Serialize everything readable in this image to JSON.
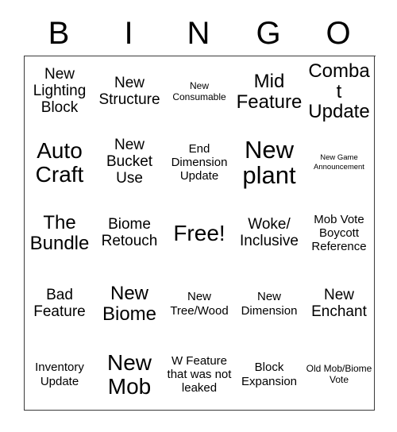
{
  "card": {
    "title_letters": [
      "B",
      "I",
      "N",
      "G",
      "O"
    ],
    "rows": [
      [
        {
          "text": "New Lighting Block",
          "size": "sz-l"
        },
        {
          "text": "New Structure",
          "size": "sz-l"
        },
        {
          "text": "New Consumable",
          "size": "sz-s"
        },
        {
          "text": "Mid Feature",
          "size": "sz-xl"
        },
        {
          "text": "Combat Update",
          "size": "sz-xl"
        }
      ],
      [
        {
          "text": "Auto Craft",
          "size": "sz-xxl"
        },
        {
          "text": "New Bucket Use",
          "size": "sz-l"
        },
        {
          "text": "End Dimension Update",
          "size": "sz-m"
        },
        {
          "text": "New plant",
          "size": "sz-huge"
        },
        {
          "text": "New Game Announcement",
          "size": "sz-xs"
        }
      ],
      [
        {
          "text": "The Bundle",
          "size": "sz-xl"
        },
        {
          "text": "Biome Retouch",
          "size": "sz-l"
        },
        {
          "text": "Free!",
          "size": "sz-xxl"
        },
        {
          "text": "Woke/ Inclusive",
          "size": "sz-l"
        },
        {
          "text": "Mob Vote Boycott Reference",
          "size": "sz-m"
        }
      ],
      [
        {
          "text": "Bad Feature",
          "size": "sz-l"
        },
        {
          "text": "New Biome",
          "size": "sz-xl"
        },
        {
          "text": "New Tree/Wood",
          "size": "sz-m"
        },
        {
          "text": "New Dimension",
          "size": "sz-m"
        },
        {
          "text": "New Enchant",
          "size": "sz-l"
        }
      ],
      [
        {
          "text": "Inventory Update",
          "size": "sz-m"
        },
        {
          "text": "New Mob",
          "size": "sz-xxl"
        },
        {
          "text": "W Feature that was not leaked",
          "size": "sz-m"
        },
        {
          "text": "Block Expansion",
          "size": "sz-m"
        },
        {
          "text": "Old Mob/Biome Vote",
          "size": "sz-s"
        }
      ]
    ],
    "colors": {
      "background": "#ffffff",
      "text": "#000000",
      "grid_line": "#3a3a3a"
    }
  }
}
